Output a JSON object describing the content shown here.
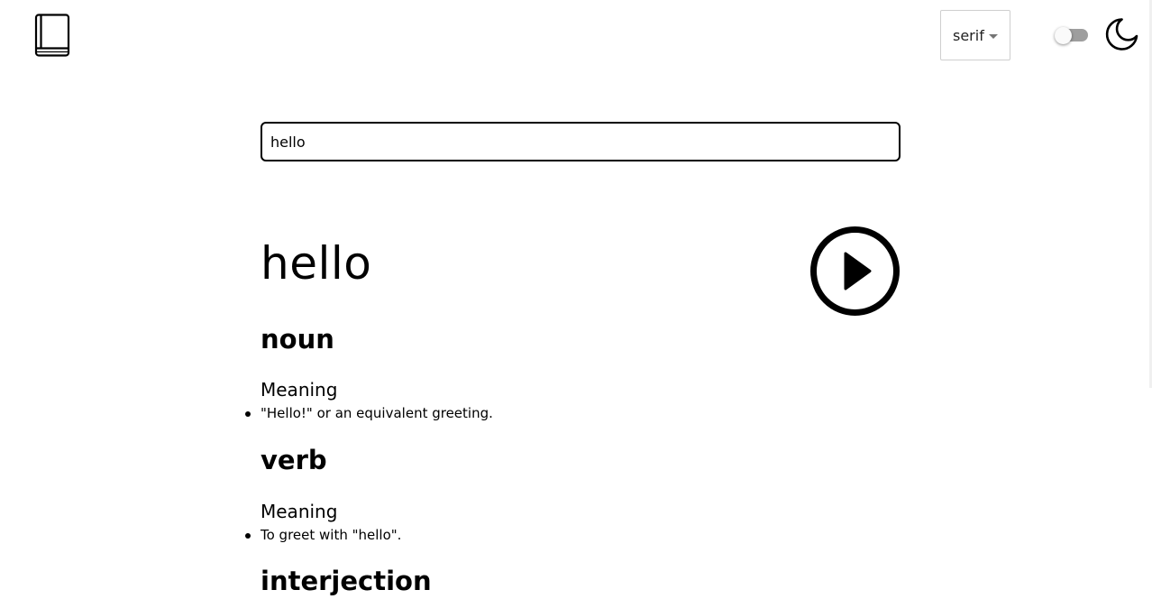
{
  "header": {
    "logo_icon": "book-icon",
    "font_select": {
      "selected": "serif"
    },
    "theme_toggle_state": "off",
    "theme_icon": "moon-icon"
  },
  "search": {
    "value": "hello"
  },
  "entry": {
    "word": "hello",
    "play_icon": "play-icon",
    "meanings": [
      {
        "part_of_speech": "noun",
        "label": "Meaning",
        "definitions": [
          "\"Hello!\" or an equivalent greeting."
        ]
      },
      {
        "part_of_speech": "verb",
        "label": "Meaning",
        "definitions": [
          "To greet with \"hello\"."
        ]
      },
      {
        "part_of_speech": "interjection"
      }
    ]
  },
  "colors": {
    "text": "#000000",
    "background": "#ffffff",
    "toggle_track": "#9e9e9e",
    "select_border": "#cfcfcf"
  }
}
